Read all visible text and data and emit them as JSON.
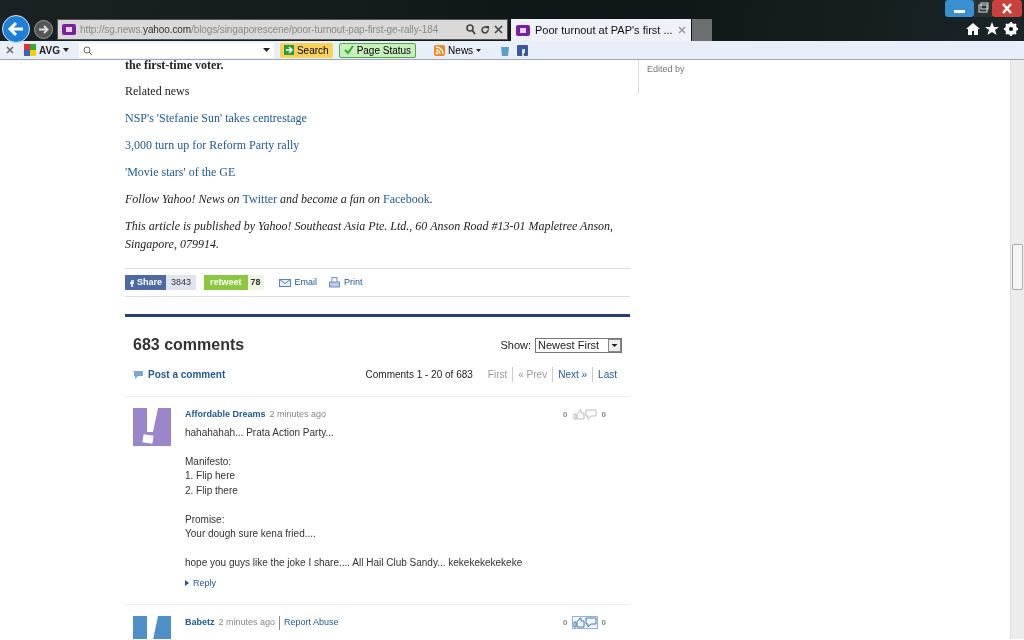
{
  "browser": {
    "address": {
      "prefix": "http://sg.news.",
      "domain": "yahoo.com",
      "path": "/blogs/singaporescene/poor-turnout-pap-first-ge-rally-184"
    },
    "tab_title": "Poor turnout at PAP's first ..."
  },
  "toolbar": {
    "avg_label": "AVG",
    "search_button": "Search",
    "page_status": "Page Status",
    "news": "News"
  },
  "article": {
    "cut_line": "the first-time voter.",
    "related_heading": "Related news",
    "related_links": [
      "NSP's 'Stefanie Sun' takes centrestage",
      "3,000 turn up for Reform Party rally",
      "'Movie stars' of the GE"
    ],
    "follow": [
      {
        "kind": "text",
        "text": "Follow Yahoo! News on "
      },
      {
        "kind": "link",
        "text": "Twitter"
      },
      {
        "kind": "text",
        "text": " and become a fan on "
      },
      {
        "kind": "link",
        "text": "Facebook"
      },
      {
        "kind": "text",
        "text": "."
      }
    ],
    "publisher": "This article is published by Yahoo! Southeast Asia Pte. Ltd., 60 Anson Road #13-01 Mapletree Anson, Singapore, 079914."
  },
  "share": {
    "facebook_label": "Share",
    "facebook_count": "3843",
    "retweet_label": "retweet",
    "retweet_count": "78",
    "email": "Email",
    "print": "Print"
  },
  "comments": {
    "title": "683 comments",
    "show_label": "Show:",
    "sort": "Newest First",
    "post_link": "Post a comment",
    "range": "Comments 1 - 20 of 683",
    "pager": [
      {
        "label": "First",
        "disabled": true
      },
      {
        "label": "« Prev",
        "disabled": true
      },
      {
        "label": "Next »",
        "disabled": false
      },
      {
        "label": "Last",
        "disabled": false
      }
    ],
    "items": [
      {
        "author": "Affordable Dreams",
        "time": "2 minutes ago",
        "color": "#9b86cc",
        "body": "hahahahah... Prata Action Party...\n\nManifesto:\n1. Flip here\n2. Flip there\n\nPromise:\nYour dough sure kena fried....\n\nhope you guys like the joke I share.... All Hail Club Sandy... kekekekekekeke",
        "reply": "Reply",
        "up": "0",
        "down": "0",
        "votes_highlighted": false
      },
      {
        "author": "Babetz",
        "time": "2 minutes ago",
        "report": "Report Abuse",
        "color": "#4f8fc8",
        "up": "0",
        "down": "0",
        "votes_highlighted": true
      }
    ]
  },
  "sidebar": {
    "edited_by": "Edited by"
  }
}
